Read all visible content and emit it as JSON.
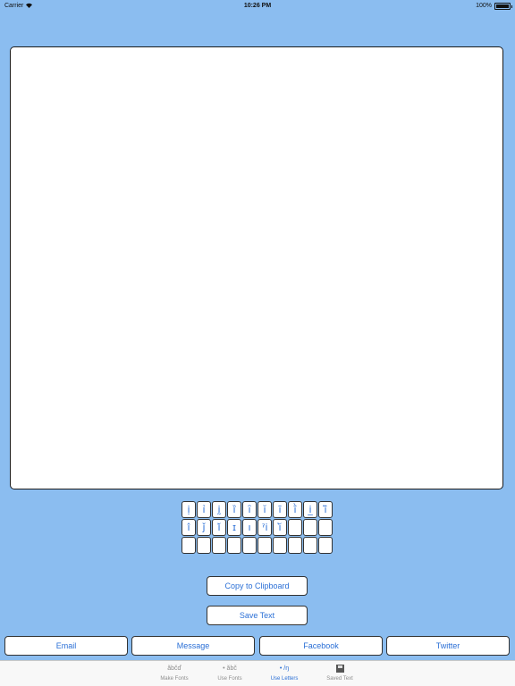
{
  "status_bar": {
    "carrier": "Carrier",
    "time": "10:26 PM",
    "battery": "100%"
  },
  "keys": [
    "ị",
    "ỉ",
    "ḭ",
    "ȉ",
    "ȋ",
    "ĭ",
    "ī",
    "ī̀",
    "i̲",
    "ī̃",
    "î",
    "ǰ",
    "ǐ́",
    "ɪ",
    "ı",
    "ˀi",
    "ĭ̀",
    "",
    "",
    "",
    "",
    "",
    "",
    "",
    "",
    "",
    "",
    "",
    "",
    ""
  ],
  "buttons": {
    "copy": "Copy to Clipboard",
    "save": "Save Text",
    "email": "Email",
    "message": "Message",
    "facebook": "Facebook",
    "twitter": "Twitter"
  },
  "tabs": [
    {
      "icon_text": "ăbčď",
      "label": "Make Fonts",
      "active": false
    },
    {
      "icon_text": "• ăbč",
      "label": "Use Fonts",
      "active": false
    },
    {
      "icon_text": "• /ŋ",
      "label": "Use Letters",
      "active": true
    },
    {
      "icon": "floppy-disk-icon",
      "label": "Saved Text",
      "active": false
    }
  ],
  "colors": {
    "background": "#8bbdf0",
    "accent": "#2a6fd6"
  }
}
